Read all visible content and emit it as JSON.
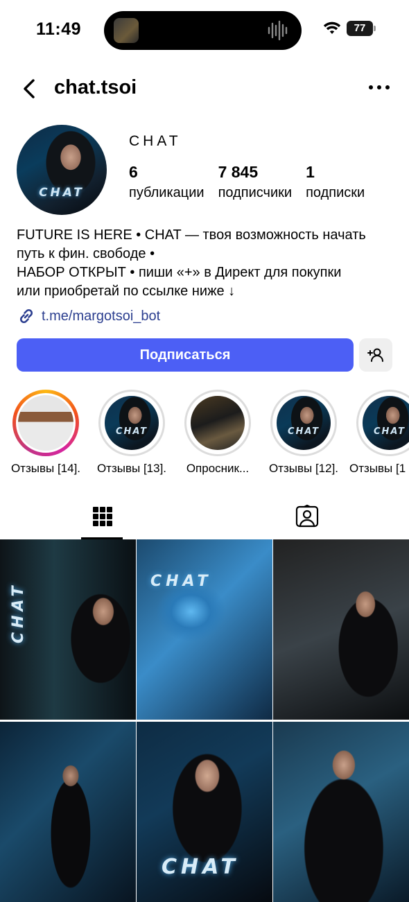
{
  "status_bar": {
    "time": "11:49",
    "battery": "77"
  },
  "header": {
    "username": "chat.tsoi"
  },
  "profile": {
    "avatar_text": "CHAT",
    "display_name": "CHAT",
    "stats": [
      {
        "value": "6",
        "label": "публикации"
      },
      {
        "value": "7 845",
        "label": "подписчики"
      },
      {
        "value": "1",
        "label": "подписки"
      }
    ],
    "bio_lines": [
      "FUTURE IS HERE • CHAT — твоя возможность начать",
      "путь к фин. свободе •",
      "НАБОР ОТКРЫТ • пиши «+» в Директ для покупки",
      "или приобретай по ссылке ниже ↓"
    ],
    "link": "t.me/margotsoi_bot"
  },
  "actions": {
    "follow_label": "Подписаться"
  },
  "highlights": [
    {
      "label": "Отзывы [14].",
      "thumb_text": ""
    },
    {
      "label": "Отзывы [13].",
      "thumb_text": "CHAT"
    },
    {
      "label": "Опросник...",
      "thumb_text": ""
    },
    {
      "label": "Отзывы [12].",
      "thumb_text": "CHAT"
    },
    {
      "label": "Отзывы [1",
      "thumb_text": "CHAT"
    }
  ],
  "grid_posts": [
    {
      "overlay_text": "CHAT"
    },
    {
      "overlay_text": "CHAT"
    },
    {
      "overlay_text": ""
    },
    {
      "overlay_text": ""
    },
    {
      "overlay_text": "CHAT"
    },
    {
      "overlay_text": ""
    }
  ],
  "colors": {
    "accent": "#4c5ff5",
    "link": "#2b3e8f"
  }
}
